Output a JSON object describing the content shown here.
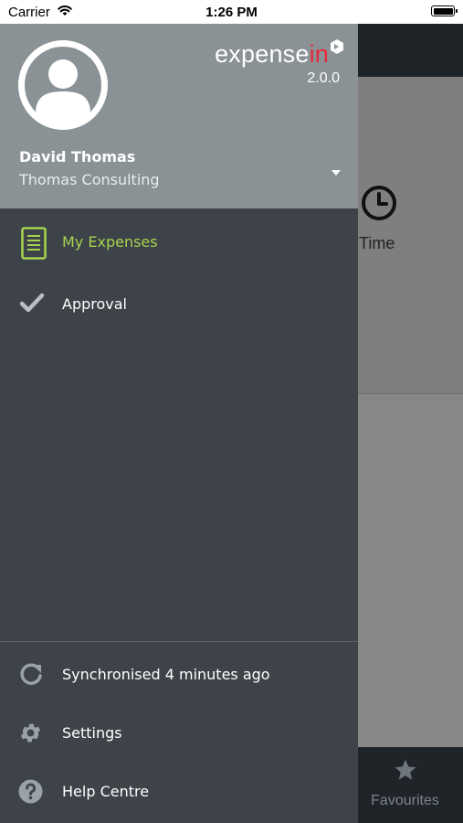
{
  "status_bar": {
    "carrier": "Carrier",
    "time": "1:26 PM"
  },
  "background": {
    "time_label": "Time",
    "favourites_label": "Favourites"
  },
  "drawer": {
    "brand": {
      "name_prefix": "expense",
      "name_suffix": "in",
      "version": "2.0.0"
    },
    "user": {
      "name": "David Thomas",
      "company": "Thomas Consulting"
    },
    "nav": [
      {
        "label": "My Expenses",
        "icon": "document-icon",
        "active": true
      },
      {
        "label": "Approval",
        "icon": "checkmark-icon",
        "active": false
      }
    ],
    "footer": [
      {
        "label": "Synchronised 4 minutes ago",
        "icon": "refresh-icon"
      },
      {
        "label": "Settings",
        "icon": "gear-icon"
      },
      {
        "label": "Help Centre",
        "icon": "help-icon"
      }
    ]
  },
  "colors": {
    "accent": "#a6d34f",
    "brand_red": "#e8293a",
    "drawer_bg": "#3d4349",
    "header_bg": "#8a9296"
  }
}
